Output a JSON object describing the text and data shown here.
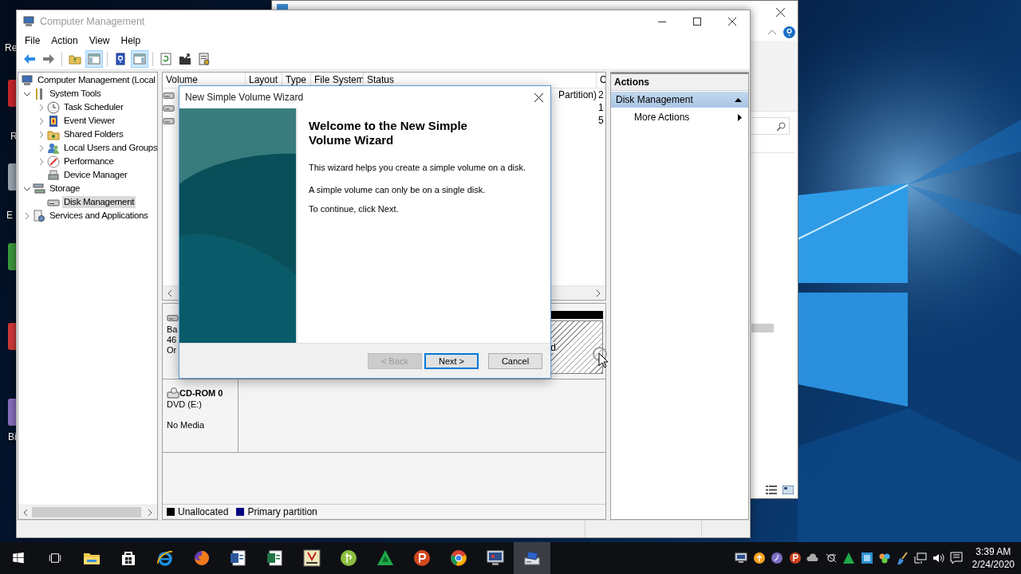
{
  "desktop": {
    "labels": [
      "Re",
      "R",
      "E",
      "Bi"
    ]
  },
  "computer_management": {
    "title": "Computer Management",
    "active": false,
    "menu": [
      "File",
      "Action",
      "View",
      "Help"
    ],
    "toolbar": [
      {
        "kind": "back",
        "on": false
      },
      {
        "kind": "forward",
        "on": false
      },
      {
        "kind": "up",
        "on": false
      },
      {
        "kind": "console-tree",
        "on": true
      },
      {
        "kind": "help",
        "on": false
      },
      {
        "kind": "action-pane",
        "on": true
      },
      {
        "kind": "refresh",
        "on": false
      },
      {
        "kind": "export",
        "on": false
      },
      {
        "kind": "properties",
        "on": false
      }
    ],
    "tree": {
      "kind": "computer",
      "label": "Computer Management (Local",
      "selected": false,
      "children": [
        {
          "kind": "tools",
          "label": "System Tools",
          "expanded": true,
          "selected": false,
          "children": [
            {
              "kind": "clock",
              "label": "Task Scheduler",
              "expanded": false,
              "selected": false
            },
            {
              "kind": "log",
              "label": "Event Viewer",
              "expanded": false,
              "selected": false
            },
            {
              "kind": "share",
              "label": "Shared Folders",
              "expanded": false,
              "selected": false
            },
            {
              "kind": "users",
              "label": "Local Users and Groups",
              "expanded": false,
              "selected": false
            },
            {
              "kind": "gauge",
              "label": "Performance",
              "expanded": false,
              "selected": false
            },
            {
              "kind": "device",
              "label": "Device Manager",
              "selected": false
            }
          ]
        },
        {
          "kind": "storage",
          "label": "Storage",
          "expanded": true,
          "selected": false,
          "children": [
            {
              "kind": "disk",
              "label": "Disk Management",
              "selected": true
            }
          ]
        },
        {
          "kind": "services",
          "label": "Services and Applications",
          "expanded": false,
          "selected": false
        }
      ]
    },
    "volumes": {
      "columns": [
        "Volume",
        "Layout",
        "Type",
        "File System",
        "Status",
        "C"
      ],
      "rows": [
        {
          "status": "Partition)",
          "column_6": "2"
        },
        {
          "column_6": "1"
        },
        {
          "column_6": "5"
        }
      ]
    },
    "disks": [
      {
        "kind": "basic",
        "lines": [
          "Ba",
          "46",
          "Or"
        ],
        "partition": "d"
      },
      {
        "kind": "cdrom",
        "name": "CD-ROM 0",
        "lines": [
          "DVD (E:)",
          "No Media"
        ]
      }
    ],
    "legend": [
      {
        "label": "Unallocated",
        "color": "#000000"
      },
      {
        "label": "Primary partition",
        "color": "#000080"
      }
    ],
    "actions": {
      "title": "Actions",
      "items": [
        {
          "kind": "section",
          "label": "Disk Management",
          "expanded": true
        },
        {
          "kind": "submenu",
          "label": "More Actions"
        }
      ]
    }
  },
  "wizard": {
    "title": "New Simple Volume Wizard",
    "heading": "Welcome to the New Simple Volume Wizard",
    "paragraphs": [
      "This wizard helps you create a simple volume on a disk.",
      "A simple volume can only be on a single disk.",
      "To continue, click Next."
    ],
    "buttons": [
      {
        "label": "< Back",
        "disabled": true,
        "default": false
      },
      {
        "label": "Next >",
        "disabled": false,
        "default": true
      },
      {
        "label": "Cancel",
        "disabled": false,
        "default": false
      }
    ]
  },
  "taskbar": {
    "apps": [
      {
        "kind": "start",
        "active": false
      },
      {
        "kind": "taskview",
        "active": false
      },
      {
        "kind": "folder",
        "active": false
      },
      {
        "kind": "store",
        "active": false
      },
      {
        "kind": "ie",
        "active": false
      },
      {
        "kind": "firefox",
        "active": false
      },
      {
        "kind": "word",
        "active": false
      },
      {
        "kind": "excel",
        "active": false
      },
      {
        "kind": "vk",
        "active": false
      },
      {
        "kind": "greencircle",
        "active": false
      },
      {
        "kind": "triangle",
        "active": false
      },
      {
        "kind": "pcircle",
        "active": false
      },
      {
        "kind": "chrome",
        "active": false
      },
      {
        "kind": "monitor",
        "active": false
      },
      {
        "kind": "compmgmt",
        "active": true
      }
    ],
    "clock": {
      "time": "3:39 AM",
      "date": "2/24/2020"
    }
  }
}
